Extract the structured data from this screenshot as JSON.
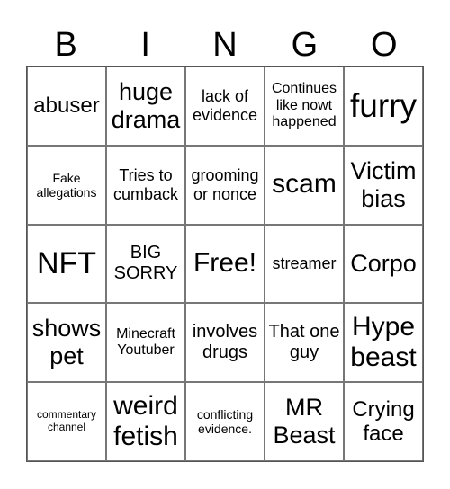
{
  "header": [
    "B",
    "I",
    "N",
    "G",
    "O"
  ],
  "cells": [
    [
      "abuser",
      "huge drama",
      "lack of evidence",
      "Continues like nowt happened",
      "furry"
    ],
    [
      "Fake allegations",
      "Tries to cumback",
      "grooming or nonce",
      "scam",
      "Victim bias"
    ],
    [
      "NFT",
      "BIG SORRY",
      "Free!",
      "streamer",
      "Corpo"
    ],
    [
      "shows pet",
      "Minecraft Youtuber",
      "involves drugs",
      "That one guy",
      "Hype beast"
    ],
    [
      "commentary channel",
      "weird fetish",
      "conflicting evidence.",
      "MR Beast",
      "Crying face"
    ]
  ]
}
